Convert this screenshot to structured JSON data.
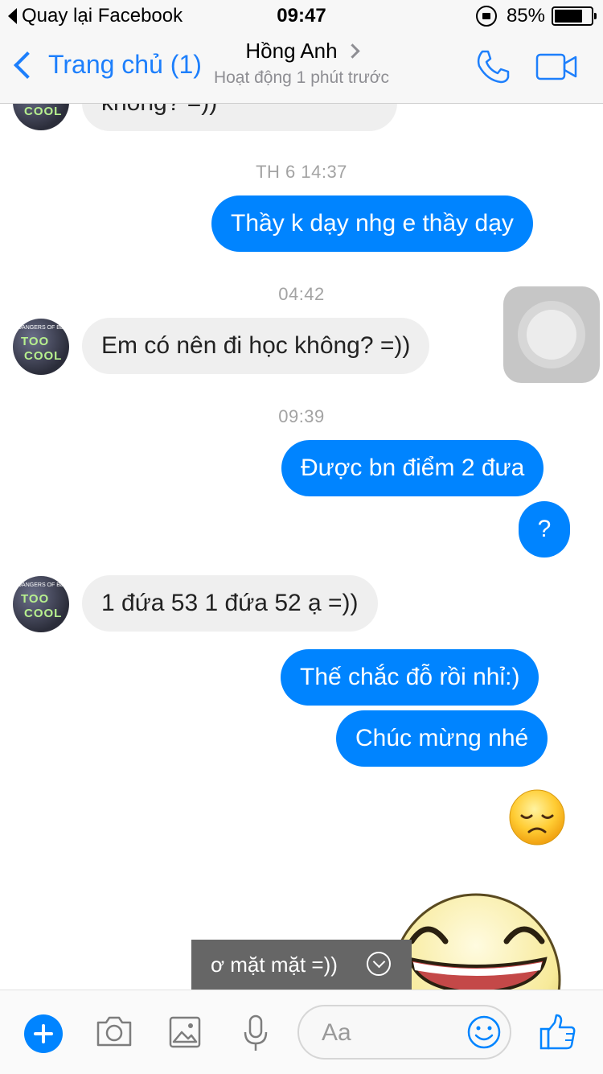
{
  "status_bar": {
    "back_app": "Quay lại Facebook",
    "time": "09:47",
    "battery": "85%",
    "battery_level": 0.85
  },
  "nav": {
    "back_label": "Trang chủ (1)",
    "contact_name": "Hồng Anh",
    "status": "Hoạt động 1 phút trước"
  },
  "messages": {
    "m0": "không? =))",
    "ts1": "TH 6 14:37",
    "m1": "Thầy k dạy nhg e thầy dạy",
    "ts2": "04:42",
    "m2": "Em có nên đi học không? =))",
    "ts3": "09:39",
    "m3": "Được bn điểm 2 đưa",
    "m4": "?",
    "m5": "1 đứa 53 1 đứa 52 ạ =))",
    "m6": "Thế chắc đỗ rồi nhỉ:)",
    "m7": "Chúc mừng nhé"
  },
  "avatar": {
    "small_text": "DANGERS OF BE",
    "line1": "TOO",
    "line2": "COOL"
  },
  "tooltip": "ơ mặt mặt =))",
  "composer": {
    "placeholder": "Aa"
  },
  "colors": {
    "accent": "#0084ff",
    "nav_blue": "#1d7ffc",
    "incoming_bubble": "#efefef"
  },
  "icons": [
    "phone-icon",
    "video-camera-icon",
    "plus-icon",
    "camera-icon",
    "image-icon",
    "microphone-icon",
    "emoji-icon",
    "thumbs-up-icon"
  ]
}
